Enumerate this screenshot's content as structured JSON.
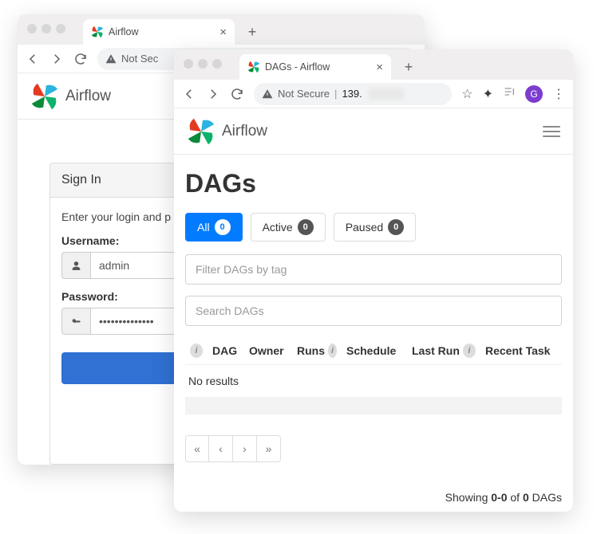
{
  "back_window": {
    "tab_title": "Airflow",
    "address_label": "Not Sec",
    "app_name": "Airflow",
    "signin_header": "Sign In",
    "signin_instructions": "Enter your login and p",
    "username_label": "Username:",
    "password_label": "Password:",
    "username_value": "admin",
    "password_value": "••••••••••••••"
  },
  "front_window": {
    "tab_title": "DAGs - Airflow",
    "address_label": "Not Secure",
    "address_ip": "139.",
    "avatar_letter": "G",
    "app_name": "Airflow",
    "page_title": "DAGs",
    "pills": {
      "all": {
        "label": "All",
        "count": "0"
      },
      "active": {
        "label": "Active",
        "count": "0"
      },
      "paused": {
        "label": "Paused",
        "count": "0"
      }
    },
    "filter_placeholder": "Filter DAGs by tag",
    "search_placeholder": "Search DAGs",
    "columns": {
      "dag": "DAG",
      "owner": "Owner",
      "runs": "Runs",
      "schedule": "Schedule",
      "lastrun": "Last Run",
      "recent": "Recent Task"
    },
    "no_results": "No results",
    "pager_first": "«",
    "pager_prev": "‹",
    "pager_next": "›",
    "pager_last": "»",
    "count_prefix": "Showing ",
    "count_range": "0-0",
    "count_mid": " of ",
    "count_total": "0",
    "count_suffix": " DAGs"
  }
}
